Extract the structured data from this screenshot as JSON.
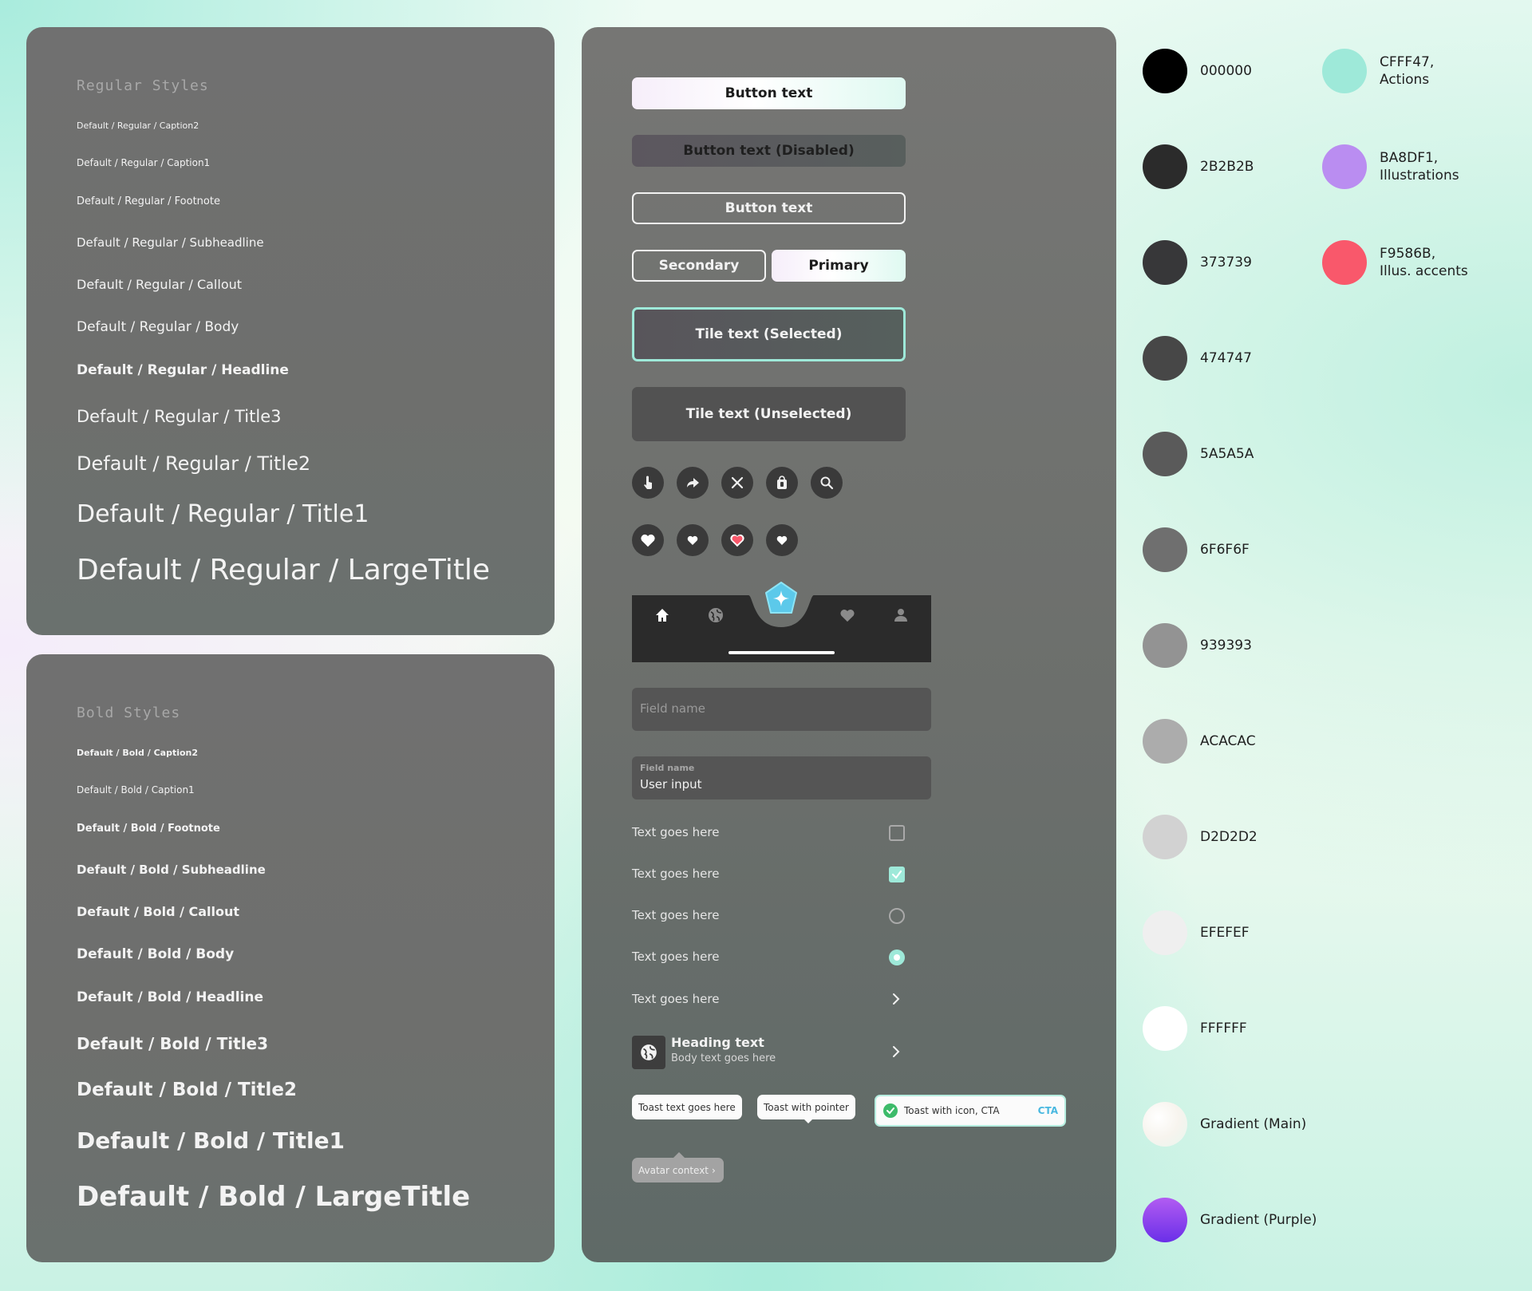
{
  "regular": {
    "title": "Regular Styles",
    "items": [
      "Default / Regular / Caption2",
      "Default / Regular / Caption1",
      "Default / Regular / Footnote",
      "Default / Regular / Subheadline",
      "Default / Regular / Callout",
      "Default / Regular / Body",
      "Default / Regular / Headline",
      "Default / Regular / Title3",
      "Default / Regular / Title2",
      "Default / Regular / Title1",
      "Default / Regular / LargeTitle"
    ]
  },
  "bold": {
    "title": "Bold Styles",
    "items": [
      "Default / Bold / Caption2",
      "Default / Bold / Caption1",
      "Default / Bold / Footnote",
      "Default / Bold / Subheadline",
      "Default / Bold / Callout",
      "Default / Bold / Body",
      "Default / Bold / Headline",
      "Default / Bold / Title3",
      "Default / Bold / Title2",
      "Default / Bold / Title1",
      "Default / Bold / LargeTitle"
    ]
  },
  "components": {
    "button_primary": "Button text",
    "button_disabled": "Button text (Disabled)",
    "button_outline": "Button text",
    "secondary": "Secondary",
    "primary": "Primary",
    "tile_selected": "Tile text (Selected)",
    "tile_unselected": "Tile text (Unselected)",
    "icon_buttons": [
      "tap-icon",
      "share-icon",
      "close-icon",
      "bag-icon",
      "search-icon"
    ],
    "heart_buttons": [
      "heart-large-icon",
      "heart-small-icon",
      "heart-filled-red-icon",
      "heart-small-icon"
    ],
    "tabbar_icons": [
      "home-icon",
      "globe-icon",
      "sparkle-icon",
      "heart-icon",
      "person-icon"
    ],
    "field_placeholder": "Field name",
    "field_label": "Field name",
    "field_value": "User input",
    "rows": [
      {
        "label": "Text goes here",
        "control": "checkbox",
        "checked": false
      },
      {
        "label": "Text goes here",
        "control": "checkbox",
        "checked": true
      },
      {
        "label": "Text goes here",
        "control": "radio",
        "checked": false
      },
      {
        "label": "Text goes here",
        "control": "radio",
        "checked": true
      },
      {
        "label": "Text goes here",
        "control": "chevron"
      }
    ],
    "list_heading": "Heading text",
    "list_body": "Body text goes here",
    "toast1": "Toast text goes here",
    "toast2": "Toast with pointer",
    "toast3": "Toast with icon, CTA",
    "toast3_cta": "CTA",
    "avatar_context": "Avatar context",
    "accent": "#9ee9d9",
    "red_heart": "#F9586B"
  },
  "colors": {
    "left": [
      {
        "hex": "#000000",
        "label": "000000"
      },
      {
        "hex": "#2B2B2B",
        "label": "2B2B2B"
      },
      {
        "hex": "#373739",
        "label": "373739"
      },
      {
        "hex": "#474747",
        "label": "474747"
      },
      {
        "hex": "#5A5A5A",
        "label": "5A5A5A"
      },
      {
        "hex": "#6F6F6F",
        "label": "6F6F6F"
      },
      {
        "hex": "#939393",
        "label": "939393"
      },
      {
        "hex": "#ACACAC",
        "label": "ACACAC"
      },
      {
        "hex": "#D2D2D2",
        "label": "D2D2D2"
      },
      {
        "hex": "#EFEFEF",
        "label": "EFEFEF"
      },
      {
        "hex": "#FFFFFF",
        "label": "FFFFFF"
      },
      {
        "hex": "gradient-main",
        "label": "Gradient (Main)"
      },
      {
        "hex": "gradient-purple",
        "label": "Gradient (Purple)"
      }
    ],
    "right": [
      {
        "hex": "#9EE9D9",
        "label": "CFFF47,",
        "label2": "Actions"
      },
      {
        "hex": "#BA8DF1",
        "label": "BA8DF1,",
        "label2": "Illustrations"
      },
      {
        "hex": "#F9586B",
        "label": "F9586B,",
        "label2": "Illus. accents"
      }
    ]
  }
}
